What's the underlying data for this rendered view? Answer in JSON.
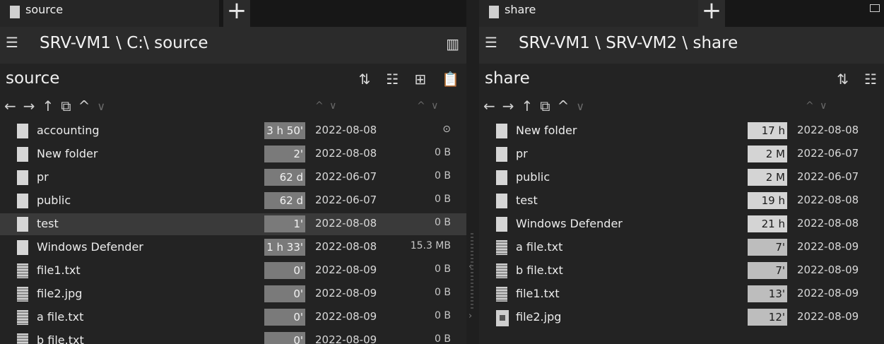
{
  "left": {
    "tab_label": "source",
    "path": "SRV-VM1 \\ C:\\ source",
    "folder_title": "source",
    "rows": [
      {
        "name": "accounting",
        "type": "folder",
        "age": "3 h 50'",
        "date": "2022-08-08",
        "size": "⊙",
        "selected": false
      },
      {
        "name": "New folder",
        "type": "folder",
        "age": "2'",
        "date": "2022-08-08",
        "size": "0 B",
        "selected": false
      },
      {
        "name": "pr",
        "type": "folder",
        "age": "62 d",
        "date": "2022-06-07",
        "size": "0 B",
        "selected": false
      },
      {
        "name": "public",
        "type": "folder",
        "age": "62 d",
        "date": "2022-06-07",
        "size": "0 B",
        "selected": false
      },
      {
        "name": "test",
        "type": "folder",
        "age": "1'",
        "date": "2022-08-08",
        "size": "0 B",
        "selected": true
      },
      {
        "name": "Windows Defender",
        "type": "folder",
        "age": "1 h 33'",
        "date": "2022-08-08",
        "size": "15.3 MB",
        "selected": false
      },
      {
        "name": "file1.txt",
        "type": "file",
        "age": "0'",
        "date": "2022-08-09",
        "size": "0 B",
        "selected": false
      },
      {
        "name": "file2.jpg",
        "type": "file",
        "age": "0'",
        "date": "2022-08-09",
        "size": "0 B",
        "selected": false
      },
      {
        "name": "a file.txt",
        "type": "file",
        "age": "0'",
        "date": "2022-08-09",
        "size": "0 B",
        "selected": false
      },
      {
        "name": "b file.txt",
        "type": "file",
        "age": "0'",
        "date": "2022-08-09",
        "size": "0 B",
        "selected": false
      }
    ]
  },
  "right": {
    "tab_label": "share",
    "path": "SRV-VM1 \\ SRV-VM2 \\ share",
    "folder_title": "share",
    "rows": [
      {
        "name": "New folder",
        "type": "folder",
        "age": "17 h",
        "date": "2022-08-08"
      },
      {
        "name": "pr",
        "type": "folder",
        "age": "2 M",
        "date": "2022-06-07"
      },
      {
        "name": "public",
        "type": "folder",
        "age": "2 M",
        "date": "2022-06-07"
      },
      {
        "name": "test",
        "type": "folder",
        "age": "19 h",
        "date": "2022-08-08"
      },
      {
        "name": "Windows Defender",
        "type": "folder",
        "age": "21 h",
        "date": "2022-08-08"
      },
      {
        "name": "a file.txt",
        "type": "file",
        "age": "7'",
        "date": "2022-08-09"
      },
      {
        "name": "b file.txt",
        "type": "file",
        "age": "7'",
        "date": "2022-08-09"
      },
      {
        "name": "file1.txt",
        "type": "file",
        "age": "13'",
        "date": "2022-08-09"
      },
      {
        "name": "file2.jpg",
        "type": "image",
        "age": "12'",
        "date": "2022-08-09"
      }
    ]
  },
  "icons": {
    "tab_add": "+",
    "menu": "☰",
    "columns": "▥",
    "sort": "⇅",
    "list_view": "☷",
    "new_item": "⊞",
    "paste": "📋",
    "nav": [
      "←",
      "→",
      "↑",
      "⧉",
      "^",
      "∨"
    ],
    "sort_toggle": "^ ∨"
  },
  "colors": {
    "age_shade_dark": "#7a7a7a",
    "age_shade_light": "#d4d4d4",
    "selected_row": "#3a3a3a"
  }
}
